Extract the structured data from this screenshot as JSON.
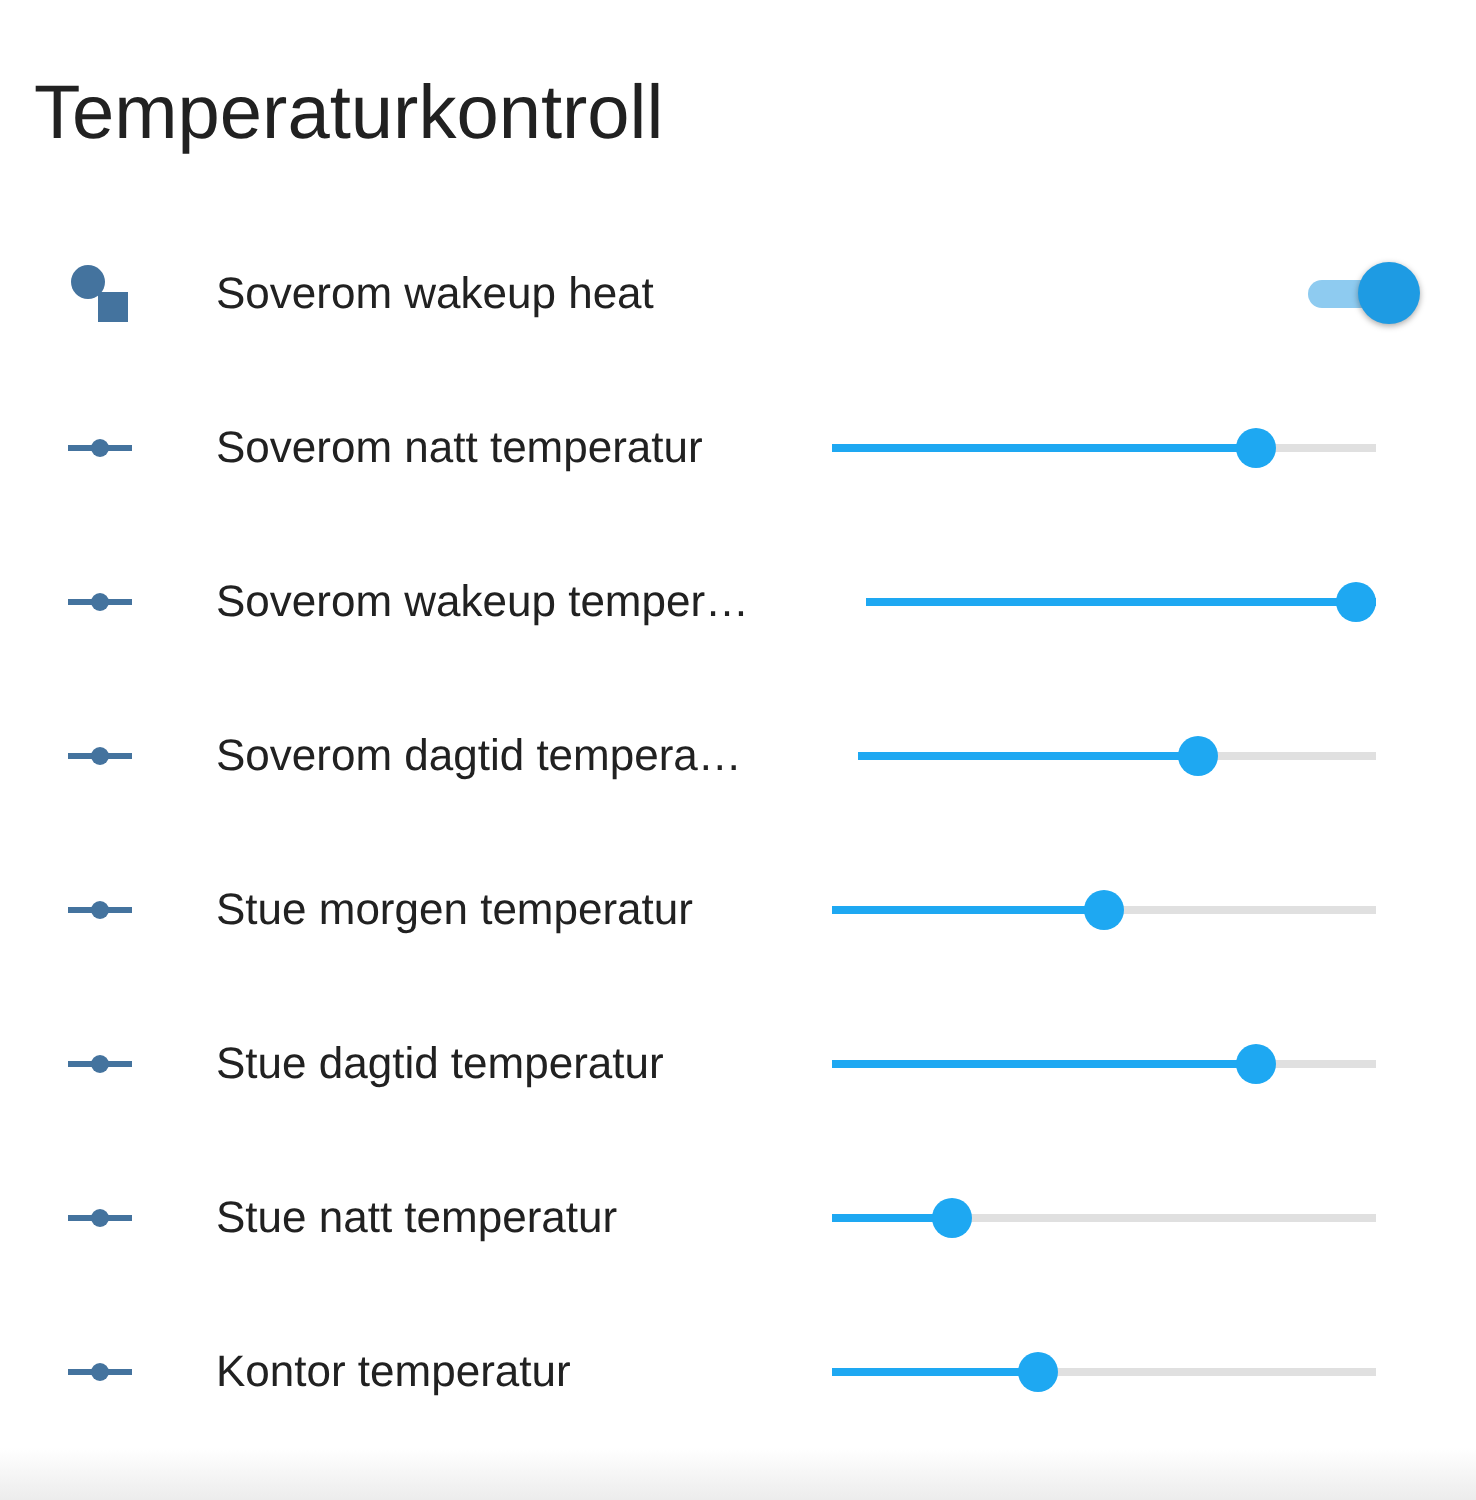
{
  "title": "Temperaturkontroll",
  "entities": [
    {
      "kind": "toggle",
      "name": "Soverom wakeup heat",
      "on": true
    },
    {
      "kind": "slider",
      "name": "Soverom natt temperatur",
      "level": 0.8
    },
    {
      "kind": "slider",
      "name": "Soverom wakeup temper…",
      "level": 1
    },
    {
      "kind": "slider",
      "name": "Soverom dagtid tempera…",
      "level": 0.67
    },
    {
      "kind": "slider",
      "name": "Stue morgen temperatur",
      "level": 0.5
    },
    {
      "kind": "slider",
      "name": "Stue dagtid temperatur",
      "level": 0.8
    },
    {
      "kind": "slider",
      "name": "Stue natt temperatur",
      "level": 0.2
    },
    {
      "kind": "slider",
      "name": "Kontor temperatur",
      "level": 0.37
    }
  ]
}
